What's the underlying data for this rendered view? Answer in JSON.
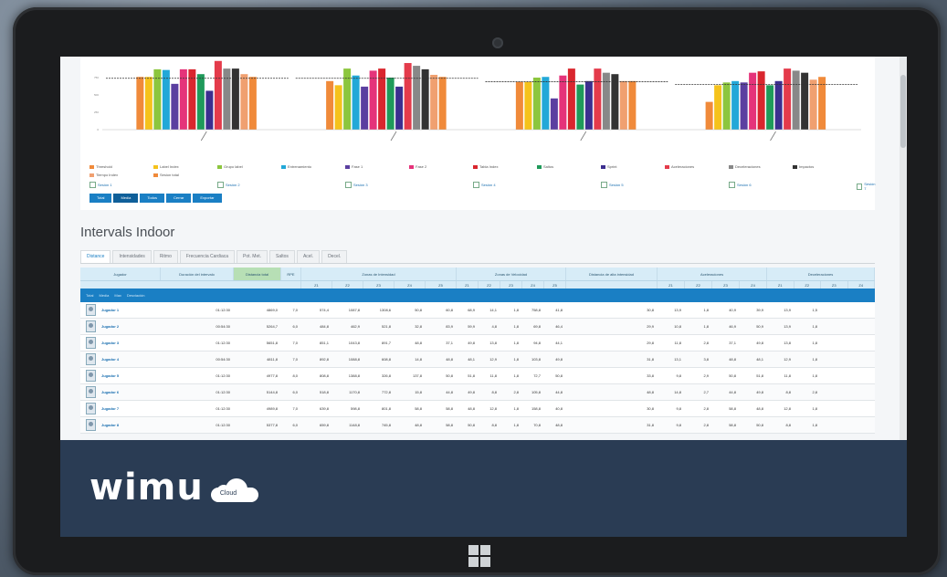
{
  "brand": {
    "logo_text": "wimu",
    "cloud_label": "Cloud",
    "accent": "#1a7fc4",
    "footer_bg": "#2a3c54"
  },
  "chart_data": {
    "type": "bar",
    "title": "",
    "ylim": [
      0,
      1000
    ],
    "groups": 4,
    "series_colors": [
      "#f08a3a",
      "#f5c21b",
      "#8cc63e",
      "#22a8d8",
      "#5b3fa0",
      "#e5337a",
      "#d9262e",
      "#1f9a5a",
      "#3c2f8f",
      "#e43b4b",
      "#888888",
      "#333333",
      "#f0a070"
    ],
    "values": [
      [
        760,
        760,
        870,
        860,
        660,
        870,
        870,
        800,
        560,
        990,
        880,
        880,
        800,
        760
      ],
      [
        700,
        640,
        880,
        780,
        620,
        850,
        880,
        750,
        620,
        960,
        920,
        870,
        790,
        760
      ],
      [
        690,
        690,
        750,
        760,
        450,
        780,
        880,
        650,
        700,
        880,
        820,
        800,
        700,
        700
      ],
      [
        400,
        640,
        680,
        700,
        680,
        820,
        840,
        640,
        700,
        880,
        850,
        820,
        720,
        760
      ]
    ],
    "reference_lines": [
      740,
      740,
      690,
      650
    ]
  },
  "legend": [
    "Threshold",
    "Label Index",
    "Grupo label",
    "Entrenamiento",
    "Fase 1",
    "Fase 2",
    "Tabla Index",
    "Saltos",
    "Sprint",
    "Aceleraciones",
    "Deceleraciones",
    "Impactos",
    "Tiempo Index",
    "Sesion total"
  ],
  "selections": [
    "Sesión 1",
    "Sesión 2",
    "Sesión 3",
    "Sesión 4",
    "Sesión 5",
    "Sesión 6",
    "Sesión 7"
  ],
  "buttons": [
    "Total",
    "Media",
    "Todos",
    "Cerrar",
    "Exportar"
  ],
  "intervals": {
    "title": "Intervals Indoor",
    "tabs": [
      "Distance",
      "Intensidades",
      "Ritmo",
      "Frecuencia Cardiaca",
      "Pot. Met.",
      "Saltos",
      "Acel.",
      "Decel."
    ],
    "active_tab": 0,
    "header_top": [
      "Jugador",
      "Duración del intervalo",
      "Distancia total",
      "RPE",
      "Zonas de Intensidad",
      "Zonas de Velocidad",
      "Distancia de alta intensidad",
      "Aceleraciones",
      "Deceleraciones"
    ],
    "header_sub": [
      "Z1",
      "Z2",
      "Z3",
      "Z4",
      "Z5",
      "Z1",
      "Z2",
      "Z3",
      "Z4",
      "Z5",
      "Z1",
      "Z2",
      "Z3",
      "Z4",
      "Z1",
      "Z2",
      "Z3",
      "Z4"
    ],
    "band_text": [
      "Total",
      "Media",
      "Max",
      "Desviación"
    ],
    "rows": [
      {
        "name": "Jugador 1",
        "vals": [
          "01:12:30",
          "4869,0",
          "7,0",
          "574,4",
          "1087,8",
          "1308,6",
          "50,8",
          "60,8",
          "68,9",
          "14,1",
          "1,8",
          "758,8",
          "41,8",
          "30,8",
          "13,9",
          "1,8",
          "40,9",
          "39,9",
          "13,9",
          "1,5"
        ]
      },
      {
        "name": "Jugador 2",
        "vals": [
          "00:54:30",
          "5264,7",
          "6,0",
          "484,8",
          "462,9",
          "521,8",
          "32,8",
          "83,9",
          "59,9",
          "4,8",
          "1,8",
          "69,8",
          "46,4",
          "29,9",
          "10,8",
          "1,8",
          "46,9",
          "50,9",
          "13,9",
          "1,8"
        ]
      },
      {
        "name": "Jugador 3",
        "vals": [
          "01:12:30",
          "5651,8",
          "7,0",
          "851,1",
          "1043,8",
          "891,7",
          "48,8",
          "37,1",
          "49,8",
          "13,8",
          "1,8",
          "94,8",
          "44,1",
          "29,8",
          "11,8",
          "2,8",
          "37,1",
          "49,8",
          "13,8",
          "1,8"
        ]
      },
      {
        "name": "Jugador 4",
        "vals": [
          "00:54:30",
          "4811,8",
          "7,0",
          "892,8",
          "1088,8",
          "608,8",
          "14,8",
          "48,8",
          "48,1",
          "12,9",
          "1,8",
          "103,8",
          "49,8",
          "31,8",
          "13,1",
          "3,8",
          "48,8",
          "48,1",
          "12,9",
          "1,8"
        ]
      },
      {
        "name": "Jugador 5",
        "vals": [
          "01:12:30",
          "4977,8",
          "8,0",
          "808,8",
          "1388,8",
          "326,8",
          "137,8",
          "50,8",
          "51,8",
          "11,8",
          "1,8",
          "72,7",
          "50,8",
          "33,8",
          "9,8",
          "2,9",
          "50,8",
          "51,8",
          "11,8",
          "1,8"
        ]
      },
      {
        "name": "Jugador 6",
        "vals": [
          "01:12:30",
          "5144,8",
          "6,0",
          "518,8",
          "1170,8",
          "772,8",
          "15,8",
          "44,8",
          "49,8",
          "8,8",
          "2,8",
          "105,8",
          "44,8",
          "48,8",
          "14,8",
          "2,7",
          "44,8",
          "49,8",
          "8,8",
          "2,8"
        ]
      },
      {
        "name": "Jugador 7",
        "vals": [
          "01:12:30",
          "4989,8",
          "7,0",
          "639,8",
          "598,8",
          "801,8",
          "58,8",
          "58,8",
          "48,8",
          "12,8",
          "1,8",
          "158,8",
          "40,8",
          "30,8",
          "9,8",
          "2,8",
          "58,8",
          "48,8",
          "12,8",
          "1,8"
        ]
      },
      {
        "name": "Jugador 8",
        "vals": [
          "01:12:30",
          "5377,8",
          "6,0",
          "659,8",
          "1148,8",
          "745,8",
          "48,8",
          "58,8",
          "50,8",
          "8,8",
          "1,8",
          "70,8",
          "48,8",
          "31,8",
          "9,8",
          "2,8",
          "58,8",
          "50,8",
          "8,8",
          "1,8"
        ]
      }
    ]
  }
}
